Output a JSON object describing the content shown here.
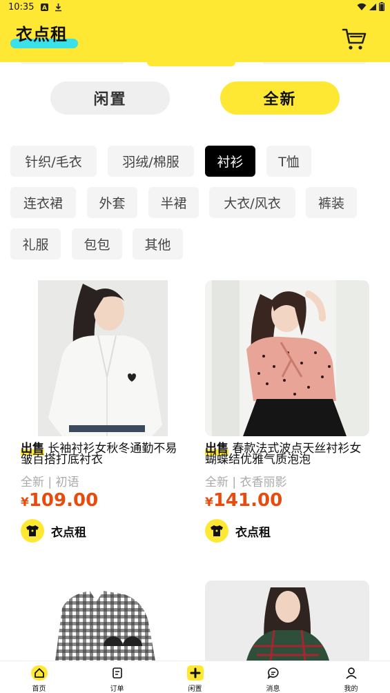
{
  "status_bar": {
    "time": "10:35"
  },
  "header": {
    "brand": "衣点租",
    "cart_icon": "cart-icon"
  },
  "mode_tabs": [
    {
      "label": "闲置",
      "active": false
    },
    {
      "label": "全新",
      "active": true
    }
  ],
  "categories": [
    {
      "label": "针织/毛衣",
      "active": false
    },
    {
      "label": "羽绒/棉服",
      "active": false
    },
    {
      "label": "衬衫",
      "active": true
    },
    {
      "label": "T恤",
      "active": false
    },
    {
      "label": "连衣裙",
      "active": false
    },
    {
      "label": "外套",
      "active": false
    },
    {
      "label": "半裙",
      "active": false
    },
    {
      "label": "大衣/风衣",
      "active": false
    },
    {
      "label": "裤装",
      "active": false
    },
    {
      "label": "礼服",
      "active": false
    },
    {
      "label": "包包",
      "active": false
    },
    {
      "label": "其他",
      "active": false
    }
  ],
  "products": [
    {
      "tag": "出售",
      "title": "长袖衬衫女秋冬通勤不易皱百搭打底衬衣",
      "condition": "全新",
      "brand": "初语",
      "currency": "¥",
      "price": "109.00",
      "shop": "衣点租"
    },
    {
      "tag": "出售",
      "title": "春款法式波点天丝衬衫女蝴蝶结优雅气质泡泡",
      "condition": "全新",
      "brand": "衣香丽影",
      "currency": "¥",
      "price": "141.00",
      "shop": "衣点租"
    }
  ],
  "bottom_nav": [
    {
      "label": "首页",
      "icon": "home-icon",
      "active": true
    },
    {
      "label": "订单",
      "icon": "order-icon",
      "active": false
    },
    {
      "label": "闲置",
      "icon": "plus-icon",
      "active": false
    },
    {
      "label": "消息",
      "icon": "message-icon",
      "active": false
    },
    {
      "label": "我的",
      "icon": "profile-icon",
      "active": false
    }
  ],
  "colors": {
    "accent": "#ffe833",
    "price": "#e84b0d",
    "highlight": "#3ce0e8"
  }
}
